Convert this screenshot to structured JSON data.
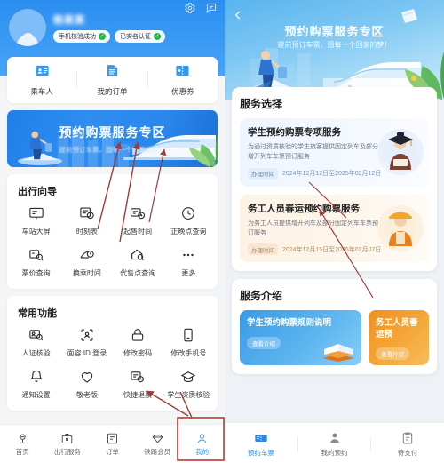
{
  "left": {
    "header": {
      "username_redacted": "杨某某",
      "settings_icon": "gear-icon",
      "message_icon": "message-icon",
      "badges": [
        {
          "label": "手机核验成功",
          "check": "✓"
        },
        {
          "label": "已实名认证",
          "check": "✓"
        }
      ]
    },
    "quick_actions": [
      {
        "label": "乘车人",
        "icon": "id-card-icon"
      },
      {
        "label": "我的订单",
        "icon": "order-list-icon"
      },
      {
        "label": "优惠券",
        "icon": "coupon-icon"
      }
    ],
    "banner": {
      "title": "预约购票服务专区",
      "subtitle": "提前预订车票，圆每一个回家的梦！"
    },
    "travel_guide": {
      "title": "出行向导",
      "items": [
        {
          "label": "车站大屏",
          "icon": "screen-icon"
        },
        {
          "label": "时刻表",
          "icon": "timetable-icon"
        },
        {
          "label": "起售时间",
          "icon": "sale-time-icon"
        },
        {
          "label": "正晚点查询",
          "icon": "clock-icon"
        },
        {
          "label": "票价查询",
          "icon": "fare-search-icon"
        },
        {
          "label": "换乘时间",
          "icon": "transfer-time-icon"
        },
        {
          "label": "代售点查询",
          "icon": "agency-search-icon"
        },
        {
          "label": "更多",
          "icon": "more-dots-icon"
        }
      ]
    },
    "common_functions": {
      "title": "常用功能",
      "items": [
        {
          "label": "人证核验",
          "icon": "id-verify-icon"
        },
        {
          "label": "面容 ID 登录",
          "icon": "face-id-icon"
        },
        {
          "label": "修改密码",
          "icon": "lock-icon"
        },
        {
          "label": "修改手机号",
          "icon": "phone-icon"
        },
        {
          "label": "通知设置",
          "icon": "bell-icon"
        },
        {
          "label": "敬老版",
          "icon": "heart-icon"
        },
        {
          "label": "快捷退票",
          "icon": "refund-icon"
        },
        {
          "label": "学生资质核验",
          "icon": "graduation-cap-icon"
        }
      ]
    },
    "bottom_nav": {
      "items": [
        {
          "label": "首页",
          "icon": "home-rail-icon",
          "active": false
        },
        {
          "label": "出行服务",
          "icon": "briefcase-icon",
          "active": false
        },
        {
          "label": "订单",
          "icon": "order-icon",
          "active": false
        },
        {
          "label": "铁路会员",
          "icon": "diamond-icon",
          "active": false
        },
        {
          "label": "我的",
          "icon": "user-icon",
          "active": true
        }
      ]
    }
  },
  "right": {
    "hero": {
      "back_icon": "chevron-left-icon",
      "title": "预约购票服务专区",
      "subtitle": "提前预订车票，圆每一个回家的梦！"
    },
    "service_selection": {
      "title": "服务选择",
      "services": [
        {
          "name": "学生预约购票专项服务",
          "desc": "为通过资质核验的学生旅客提供固定列车及部分增开列车车票预订服务",
          "time_label": "办理时间",
          "time_value": "2024年12月12日至2025年02月12日",
          "figure": "student-graduate-icon"
        },
        {
          "name": "务工人员春运预约购票服务",
          "desc": "为务工人员提供增开列车及部分固定列车车票预订服务",
          "time_label": "办理时间",
          "time_value": "2024年12月15日至2025年02月07日",
          "figure": "worker-icon"
        }
      ]
    },
    "service_intro": {
      "title": "服务介绍",
      "cards": [
        {
          "title": "学生预约购票规则说明",
          "button": "查看介绍",
          "color": "#3b9ae6",
          "icon": "open-book-icon"
        },
        {
          "title": "务工人员春运预",
          "button": "查看介绍",
          "color": "#f0901f",
          "icon": "worker-intro-icon"
        }
      ]
    },
    "bottom_nav": {
      "items": [
        {
          "label": "预约车票",
          "icon": "ticket-icon",
          "active": true
        },
        {
          "label": "我的预约",
          "icon": "person-icon",
          "active": false
        },
        {
          "label": "待支付",
          "icon": "clipboard-icon",
          "active": false
        }
      ]
    }
  },
  "annotations": {
    "highlight_color": "#c0392b",
    "arrow_color": "#a33a3a"
  }
}
